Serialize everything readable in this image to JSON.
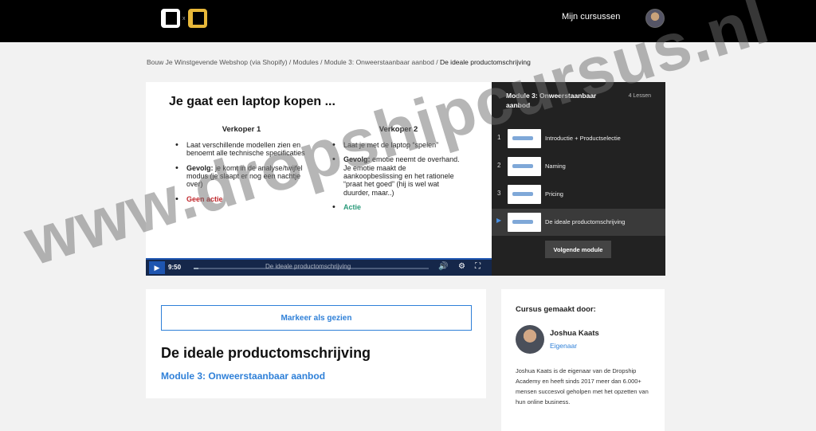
{
  "header": {
    "logo_x": "x",
    "nav_link": "Mijn cursussen"
  },
  "breadcrumb": {
    "items": [
      "Bouw Je Winstgevende Webshop (via Shopify)",
      "Modules",
      "Module 3: Onweerstaanbaar aanbod"
    ],
    "separator": " / ",
    "current": "De ideale productomschrijving"
  },
  "slide": {
    "title": "Je gaat een laptop kopen ...",
    "col1": {
      "heading": "Verkoper 1",
      "b1": "Laat verschillende modellen zien en benoemt alle technische specificaties",
      "b2_bold": "Gevolg:",
      "b2_rest": " je komt in de analyse/twijfel modus (je slaapt er nog een nachtje over)",
      "b3": "Geen actie"
    },
    "col2": {
      "heading": "Verkoper 2",
      "b1": "Laat je met de laptop “spelen”",
      "b2_bold": "Gevolg:",
      "b2_rest": " emotie neemt de overhand. Je emotie maakt de aankoopbeslissing en het rationele “praat het goed” (hij is wel wat duurder, maar..)",
      "b3": "Actie"
    }
  },
  "player": {
    "time": "9:50",
    "chapter": "De ideale productomschrijving",
    "progress": 0.02
  },
  "playlist": {
    "title": "Module 3: Onweerstaanbaar aanbod",
    "count": "4 Lessen",
    "items": [
      {
        "num": "1",
        "label": "Introductie + Productselectie"
      },
      {
        "num": "2",
        "label": "Naming"
      },
      {
        "num": "3",
        "label": "Pricing"
      },
      {
        "num": "",
        "label": "De ideale productomschrijving"
      }
    ],
    "next_label": "Volgende module"
  },
  "lesson": {
    "mark_label": "Markeer als gezien",
    "title": "De ideale productomschrijving",
    "module_link": "Module 3: Onweerstaanbaar aanbod"
  },
  "author": {
    "heading": "Cursus gemaakt door:",
    "name": "Joshua Kaats",
    "role": "Eigenaar",
    "bio": "Joshua Kaats is de eigenaar van de Dropship Academy en heeft sinds 2017 meer dan 6.000+ mensen succesvol geholpen met het opzetten van hun online business."
  },
  "watermark": "www.dropshipcursus.nl",
  "colors": {
    "accent": "#2f80d8",
    "gold": "#e8b83a",
    "header_bg": "#000000"
  }
}
